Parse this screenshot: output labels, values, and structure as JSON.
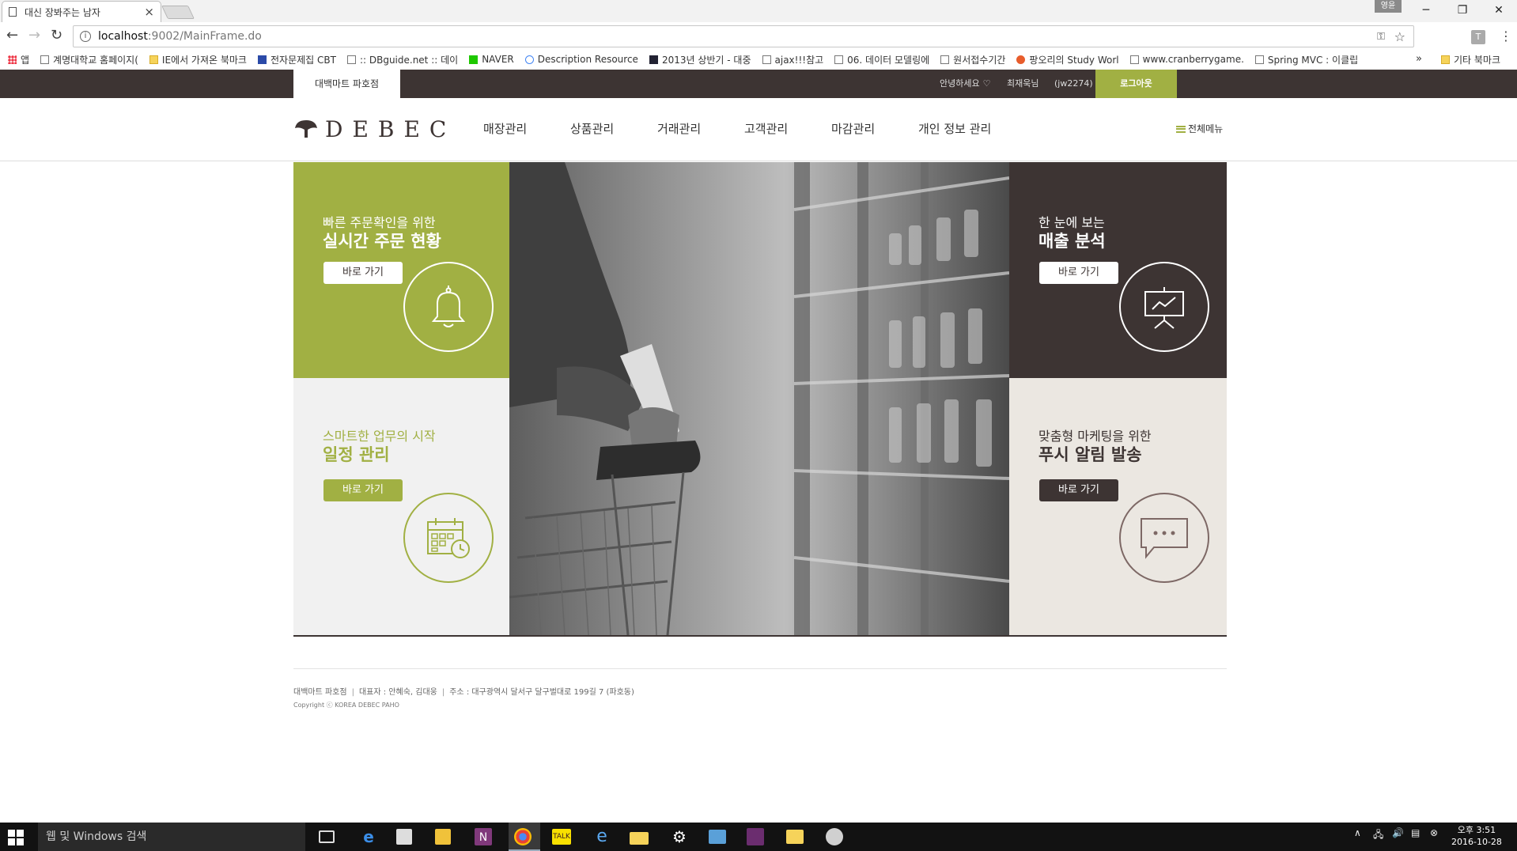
{
  "browser": {
    "tab_title": "대신 장봐주는 남자",
    "tab_close": "×",
    "url_host": "localhost",
    "url_path": ":9002/MainFrame.do",
    "profile_label": "영윤",
    "bookmarks": [
      {
        "label": "앱",
        "icon": "apps"
      },
      {
        "label": "계명대학교 홈페이지(",
        "icon": "doc"
      },
      {
        "label": "IE에서 가져온 북마크",
        "icon": "folder"
      },
      {
        "label": "전자문제집 CBT",
        "icon": "gsc"
      },
      {
        "label": ":: DBguide.net :: 데이",
        "icon": "doc"
      },
      {
        "label": "NAVER",
        "icon": "naver"
      },
      {
        "label": "Description Resource",
        "icon": "g"
      },
      {
        "label": "2013년 상반기 - 대중",
        "icon": "dark"
      },
      {
        "label": "ajax!!!참고",
        "icon": "doc"
      },
      {
        "label": "06. 데이터 모델링에 ",
        "icon": "doc"
      },
      {
        "label": "원서접수기간",
        "icon": "doc"
      },
      {
        "label": "팡오리의 Study Worl",
        "icon": "orange"
      },
      {
        "label": "www.cranberrygame.",
        "icon": "doc"
      },
      {
        "label": "Spring MVC : 이클립",
        "icon": "doc"
      }
    ],
    "bookmarks_more": "»",
    "other_bookmarks": "기타 북마크"
  },
  "site": {
    "store_tab": "대백마트 파호점",
    "greeting": "안녕하세요",
    "greeting_heart": "♡",
    "user_name": "최재욱님",
    "user_id": "(jw2274)",
    "logout": "로그아웃",
    "logo_text": "DEBEC",
    "nav": [
      "매장관리",
      "상품관리",
      "거래관리",
      "고객관리",
      "마감관리",
      "개인 정보 관리"
    ],
    "full_menu": "전체메뉴",
    "panels": {
      "orders": {
        "subtitle": "빠른 주문확인을 위한",
        "title": "실시간 주문 현황",
        "button": "바로 가기",
        "icon": "bell-icon"
      },
      "schedule": {
        "subtitle": "스마트한 업무의 시작",
        "title": "일정 관리",
        "button": "바로 가기",
        "icon": "calendar-icon"
      },
      "sales": {
        "subtitle": "한 눈에 보는",
        "title": "매출 분석",
        "button": "바로 가기",
        "icon": "presentation-chart-icon"
      },
      "push": {
        "subtitle": "맞춤형 마케팅을 위한",
        "title": "푸시 알림 발송",
        "button": "바로 가기",
        "icon": "chat-bubble-icon"
      }
    },
    "footer": {
      "store": "대백마트 파호점",
      "ceo": "대표자 : 안혜숙, 김대웅",
      "address": "주소 : 대구광역시 달서구 달구벌대로 199길 7 (파호동)",
      "copyright": "Copyright ⓒ KOREA DEBEC PAHO"
    },
    "colors": {
      "green": "#a1b043",
      "dark": "#3d3433",
      "light": "#f1f1f1",
      "beige": "#ebe7e1"
    }
  },
  "taskbar": {
    "search_placeholder": "웹 및 Windows 검색",
    "time": "오후 3:51",
    "date": "2016-10-28"
  }
}
